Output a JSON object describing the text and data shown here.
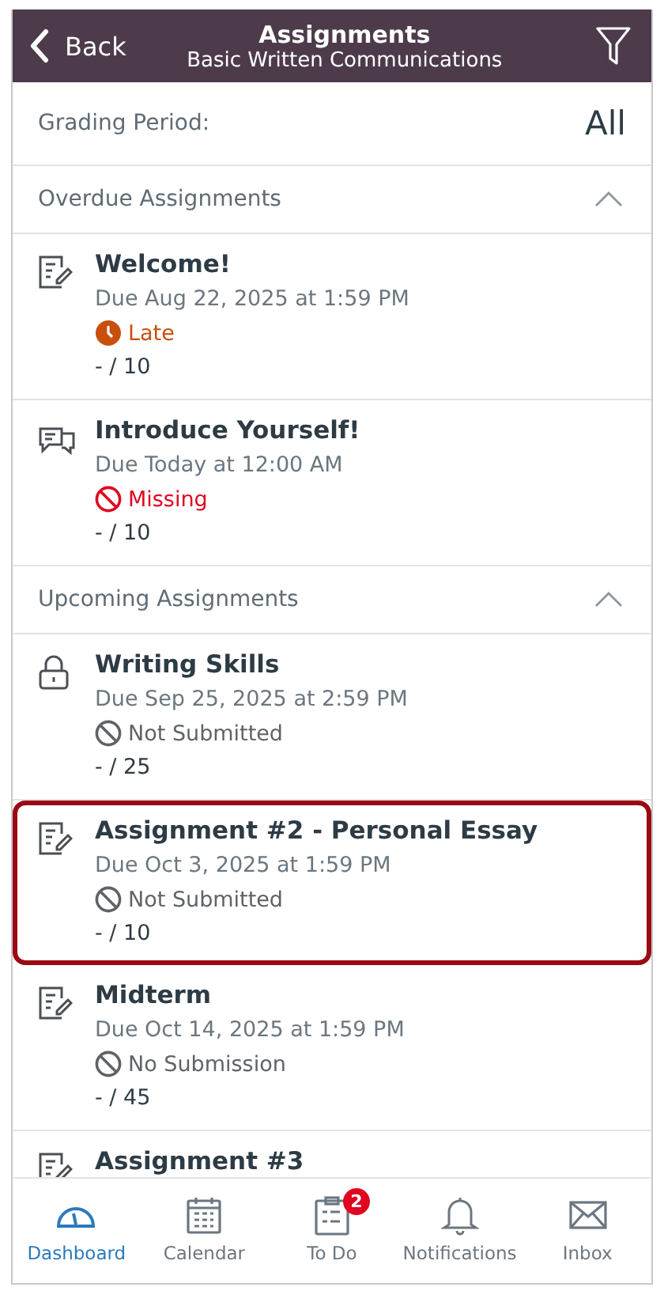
{
  "header": {
    "back": "Back",
    "title": "Assignments",
    "subtitle": "Basic Written Communications"
  },
  "grading_period": {
    "label": "Grading Period:",
    "value": "All"
  },
  "sections": [
    {
      "title": "Overdue Assignments",
      "expanded": true,
      "items": [
        {
          "kind": "assignment",
          "title": "Welcome!",
          "due": "Due Aug 22, 2025 at 1:59 PM",
          "status": {
            "kind": "late",
            "label": "Late"
          },
          "points": "- / 10",
          "highlighted": false
        },
        {
          "kind": "discussion",
          "title": "Introduce Yourself!",
          "due": "Due Today at 12:00 AM",
          "status": {
            "kind": "missing",
            "label": "Missing"
          },
          "points": "- / 10",
          "highlighted": false
        }
      ]
    },
    {
      "title": "Upcoming Assignments",
      "expanded": true,
      "items": [
        {
          "kind": "locked",
          "title": "Writing Skills",
          "due": "Due Sep 25, 2025 at 2:59 PM",
          "status": {
            "kind": "not_submitted",
            "label": "Not Submitted"
          },
          "points": "- / 25",
          "highlighted": false
        },
        {
          "kind": "assignment",
          "title": "Assignment #2 - Personal Essay",
          "due": "Due Oct 3, 2025 at 1:59 PM",
          "status": {
            "kind": "not_submitted",
            "label": "Not Submitted"
          },
          "points": "- / 10",
          "highlighted": true
        },
        {
          "kind": "assignment",
          "title": "Midterm",
          "due": "Due Oct 14, 2025 at 1:59 PM",
          "status": {
            "kind": "not_submitted",
            "label": "No Submission"
          },
          "points": "- / 45",
          "highlighted": false
        },
        {
          "kind": "assignment",
          "title": "Assignment #3",
          "highlighted": false
        }
      ]
    }
  ],
  "tab_bar": [
    {
      "kind": "dashboard",
      "label": "Dashboard",
      "selected": true
    },
    {
      "kind": "calendar",
      "label": "Calendar",
      "selected": false
    },
    {
      "kind": "todo",
      "label": "To Do",
      "selected": false,
      "badge": "2"
    },
    {
      "kind": "notifications",
      "label": "Notifications",
      "selected": false
    },
    {
      "kind": "inbox",
      "label": "Inbox",
      "selected": false
    }
  ]
}
